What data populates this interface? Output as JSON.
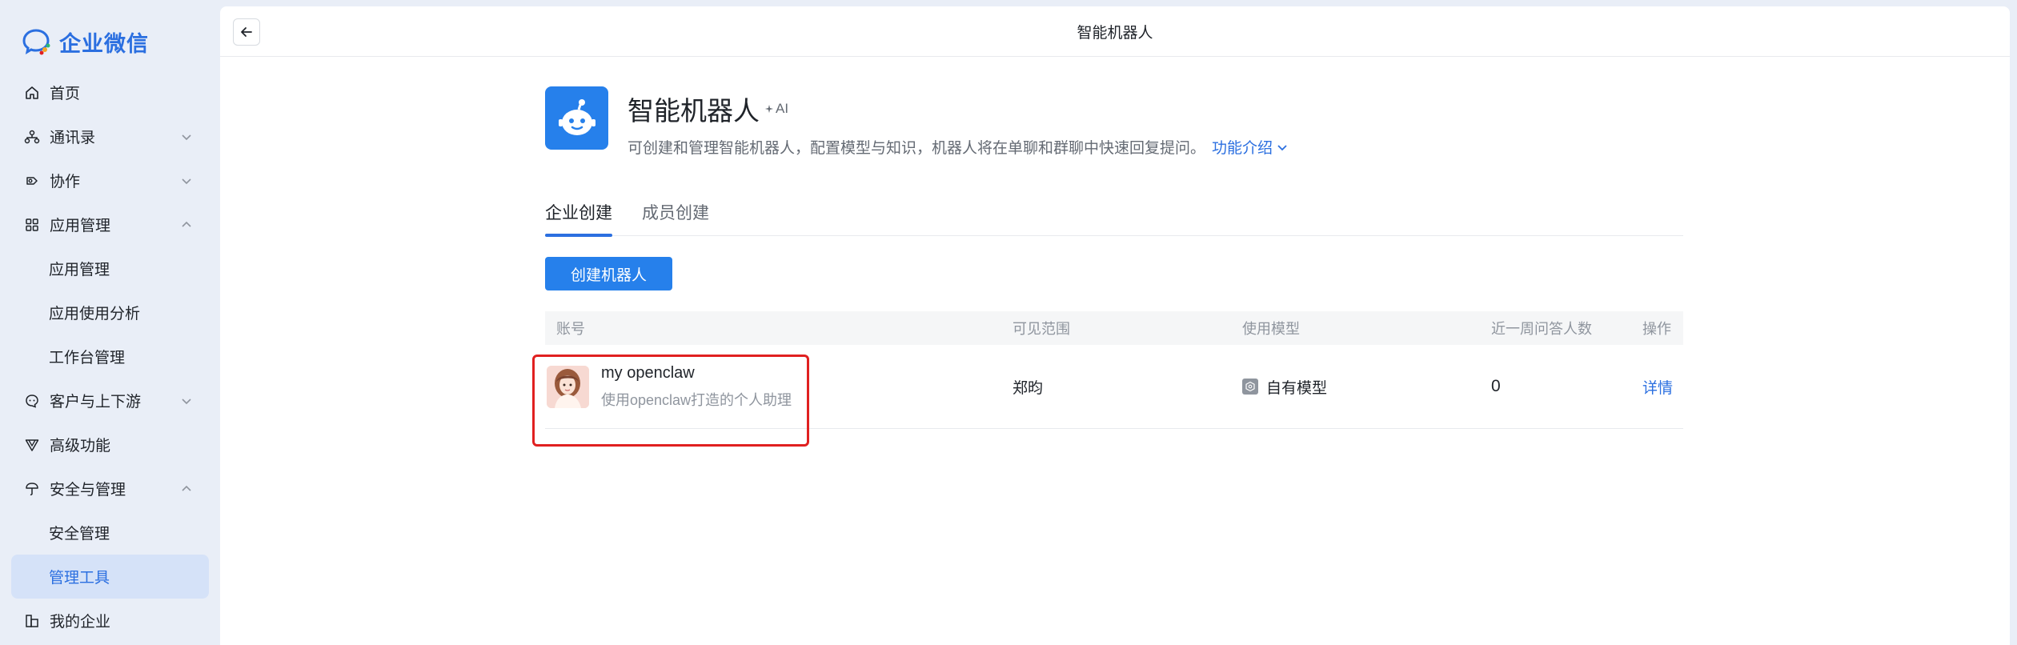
{
  "app": {
    "brand": "企业微信"
  },
  "sidebar": {
    "items": [
      {
        "label": "首页",
        "icon": "home-icon"
      },
      {
        "label": "通讯录",
        "icon": "contacts-icon"
      },
      {
        "label": "协作",
        "icon": "collab-icon"
      },
      {
        "label": "应用管理",
        "icon": "apps-icon"
      },
      {
        "label": "应用管理"
      },
      {
        "label": "应用使用分析"
      },
      {
        "label": "工作台管理"
      },
      {
        "label": "客户与上下游",
        "icon": "customer-icon"
      },
      {
        "label": "高级功能",
        "icon": "advanced-icon"
      },
      {
        "label": "安全与管理",
        "icon": "security-icon"
      },
      {
        "label": "安全管理"
      },
      {
        "label": "管理工具"
      },
      {
        "label": "我的企业",
        "icon": "enterprise-icon"
      }
    ]
  },
  "topbar": {
    "title": "智能机器人"
  },
  "header": {
    "title": "智能机器人",
    "ai_badge": "AI",
    "description": "可创建和管理智能机器人，配置模型与知识，机器人将在单聊和群聊中快速回复提问。",
    "intro_link": "功能介绍"
  },
  "tabs": [
    {
      "label": "企业创建"
    },
    {
      "label": "成员创建"
    }
  ],
  "create_button": "创建机器人",
  "table": {
    "columns": [
      "账号",
      "可见范围",
      "使用模型",
      "近一周问答人数",
      "操作"
    ],
    "rows": [
      {
        "name": "my openclaw",
        "subtitle": "使用openclaw打造的个人助理",
        "visibility": "郑昀",
        "model": "自有模型",
        "weekly_users": "0",
        "action": "详情"
      }
    ]
  },
  "colors": {
    "accent": "#2b6fe0",
    "button": "#2680eb",
    "highlight": "#e02020"
  }
}
